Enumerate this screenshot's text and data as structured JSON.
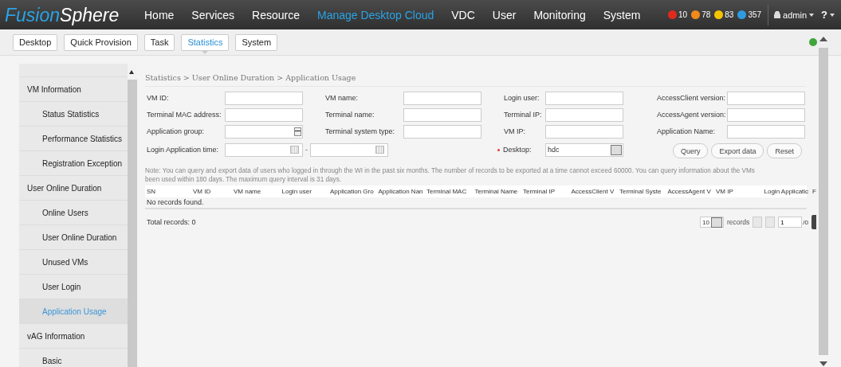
{
  "top_bar": {
    "logo": {
      "part_1": "Fusion",
      "part_2": "Sphere"
    },
    "nav": [
      {
        "label": "Home",
        "selected": false
      },
      {
        "label": "Services",
        "selected": false
      },
      {
        "label": "Resource",
        "selected": false
      },
      {
        "label": "Manage Desktop Cloud",
        "selected": true
      },
      {
        "label": "VDC",
        "selected": false
      },
      {
        "label": "User",
        "selected": false
      },
      {
        "label": "Monitoring",
        "selected": false
      },
      {
        "label": "System",
        "selected": false
      }
    ],
    "alarms": [
      {
        "count": "10",
        "color": "#e02a1e"
      },
      {
        "count": "78",
        "color": "#f28a1a"
      },
      {
        "count": "83",
        "color": "#f5c400"
      },
      {
        "count": "357",
        "color": "#2e9be0"
      }
    ],
    "user": "admin",
    "help": "?"
  },
  "sub_tab_groups": [
    [
      {
        "label": "Desktop",
        "selected": false
      },
      {
        "label": "Quick Provision",
        "selected": false
      }
    ],
    [
      {
        "label": "Task",
        "selected": false
      },
      {
        "label": "Statistics",
        "selected": true
      },
      {
        "label": "System",
        "selected": false
      }
    ]
  ],
  "sidebar": {
    "items": [
      {
        "label": "VM Information",
        "children": [
          {
            "label": "Status Statistics",
            "selected": false
          },
          {
            "label": "Performance Statistics",
            "selected": false
          },
          {
            "label": "Registration Exception",
            "selected": false
          }
        ]
      },
      {
        "label": "User Online Duration",
        "children": [
          {
            "label": "Online Users",
            "selected": false
          },
          {
            "label": "User Online Duration",
            "selected": false
          },
          {
            "label": "Unused VMs",
            "selected": false
          },
          {
            "label": "User Login",
            "selected": false
          },
          {
            "label": "Application Usage",
            "selected": true
          }
        ]
      },
      {
        "label": "vAG Information",
        "children": [
          {
            "label": "Basic",
            "selected": false
          }
        ]
      }
    ]
  },
  "breadcrumb": "Statistics > User Online Duration > Application Usage",
  "form": {
    "fields": [
      {
        "label": "VM ID:",
        "kind": "text"
      },
      {
        "label": "VM name:",
        "kind": "text"
      },
      {
        "label": "Login user:",
        "kind": "text"
      },
      {
        "label": "AccessClient version:",
        "kind": "text"
      },
      {
        "label": "Terminal MAC address:",
        "kind": "text"
      },
      {
        "label": "Terminal name:",
        "kind": "text"
      },
      {
        "label": "Terminal IP:",
        "kind": "text"
      },
      {
        "label": "AccessAgent version:",
        "kind": "text"
      },
      {
        "label": "Application group:",
        "kind": "select"
      },
      {
        "label": "Terminal system type:",
        "kind": "text"
      },
      {
        "label": "VM IP:",
        "kind": "text"
      },
      {
        "label": "Application Name:",
        "kind": "text"
      },
      {
        "label": "Login Application time:",
        "kind": "daterange",
        "separator": "-"
      },
      {
        "label": "Desktop:",
        "kind": "select",
        "required": true,
        "value": "hdc"
      }
    ],
    "buttons": [
      "Query",
      "Export data",
      "Reset"
    ]
  },
  "note": [
    "Note: You can query and export data of users who logged in through the WI in the past six months. The number of records to be exported at a time cannot exceed 60000. You can query information about the VMs",
    "been used within 180 days. The maximum query interval is 31 days."
  ],
  "table": {
    "columns": [
      "SN",
      "VM ID",
      "VM name",
      "Login user",
      "Application Gro",
      "Application Nan",
      "Terminal MAC",
      "Terminal Name",
      "Terminal IP",
      "AccessClient V",
      "Terminal Syste",
      "AccessAgent V",
      "VM IP",
      "Login Applicatic",
      "F"
    ],
    "empty_text": "No records found."
  },
  "footer": {
    "total": "Total records: 0",
    "page_size": "10",
    "records_label": "records",
    "page": "1",
    "page_total": "/0"
  }
}
